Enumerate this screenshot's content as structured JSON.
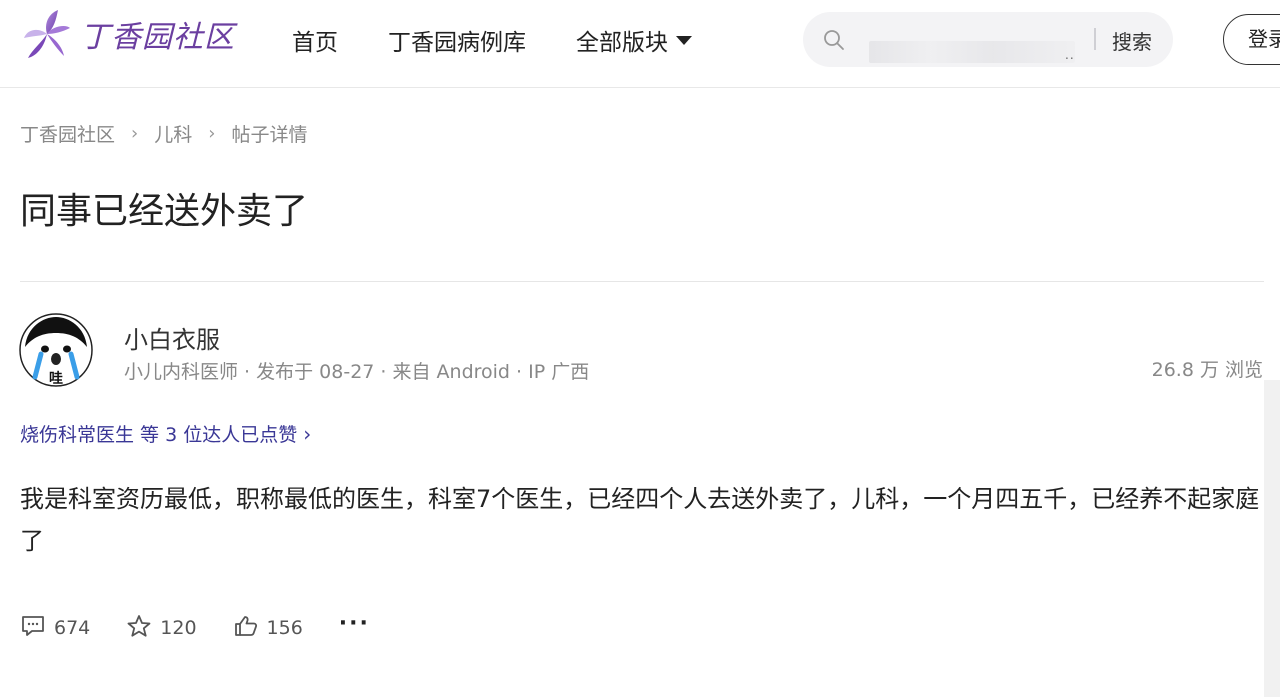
{
  "header": {
    "logo_text": "丁香园社区",
    "nav": [
      "首页",
      "丁香园病例库",
      "全部版块"
    ],
    "search": {
      "placeholder": "",
      "dots": "..",
      "button_label": "搜索"
    },
    "login_label": "登录"
  },
  "breadcrumb": [
    "丁香园社区",
    "儿科",
    "帖子详情"
  ],
  "post": {
    "title": "同事已经送外卖了",
    "author": {
      "name": "小白衣服",
      "meta": "小儿内科医师 · 发布于 08-27 · 来自 Android · IP 广西",
      "avatar_text": "哇"
    },
    "views": "26.8 万 浏览",
    "likers": "烧伤科常医生 等 3 位达人已点赞",
    "content": "我是科室资历最低，职称最低的医生，科室7个医生，已经四个人去送外卖了，儿科，一个月四五千，已经养不起家庭了",
    "stats": {
      "comments": "674",
      "favorites": "120",
      "likes": "156"
    }
  },
  "colors": {
    "brand": "#6b3fa0",
    "link": "#3a3796"
  }
}
